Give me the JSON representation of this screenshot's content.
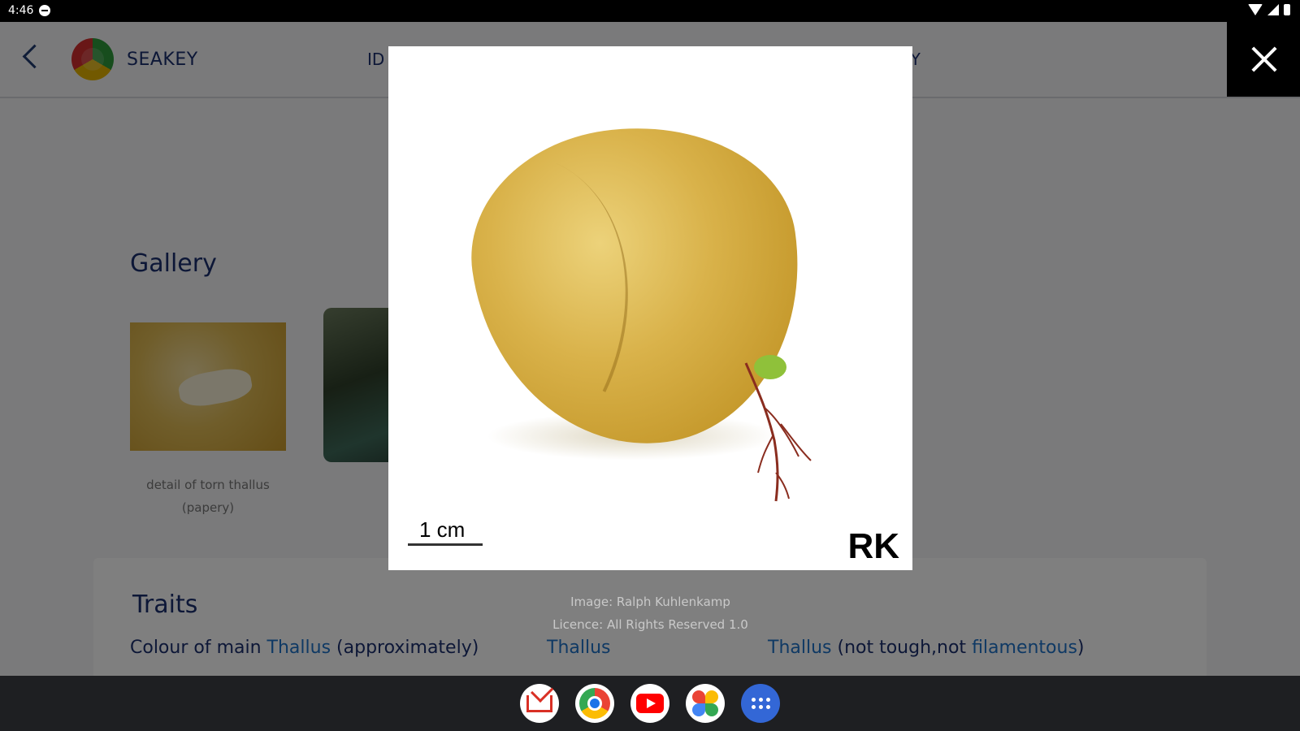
{
  "status_bar": {
    "time": "4:46"
  },
  "app_bar": {
    "app_name": "SEAKEY",
    "nav_left_label": "ID",
    "nav_right_label": "RY"
  },
  "gallery": {
    "title": "Gallery",
    "thumbnail_caption": "detail of torn thallus (papery)"
  },
  "traits": {
    "title": "Traits",
    "row_1": {
      "prefix": "Colour of main ",
      "link": "Thallus",
      "suffix": " (approximately)"
    },
    "row_2": {
      "link": "Thallus"
    },
    "row_3": {
      "link": "Thallus",
      "middle": " (not tough,not ",
      "link2": "filamentous",
      "suffix": ")"
    }
  },
  "lightbox": {
    "scale_label": "1 cm",
    "watermark": "RK",
    "credit": "Image: Ralph Kuhlenkamp",
    "licence": "Licence: All Rights Reserved 1.0"
  },
  "dock": {
    "apps": [
      "gmail-icon",
      "chrome-icon",
      "youtube-icon",
      "photos-icon",
      "apps-grid-icon"
    ]
  },
  "colors": {
    "brand_navy": "#1a2f6e",
    "link_blue": "#1e73c9",
    "scrim": "#000000"
  }
}
